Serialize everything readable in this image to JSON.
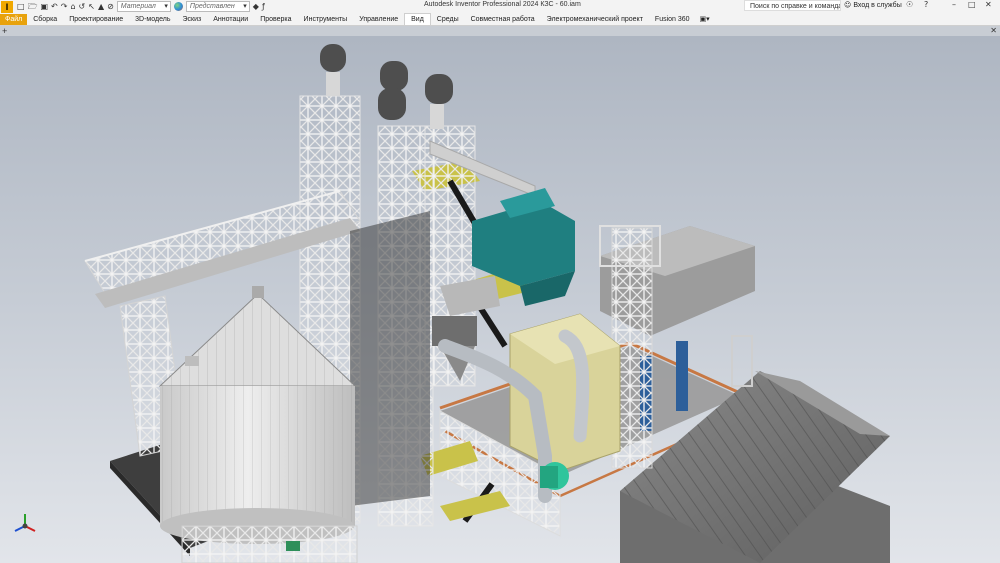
{
  "titlebar": {
    "logo": "I",
    "material_dropdown": "Материал",
    "appearance_dropdown": "Представлен",
    "app_title": "Autodesk Inventor Professional 2024  КЗС - 60.iam",
    "help_search_placeholder": "Поиск по справке и командам...",
    "sign_in": "Вход в службы"
  },
  "ribbon": {
    "file_tab": "Файл",
    "tabs": [
      "Сборка",
      "Проектирование",
      "3D-модель",
      "Эскиз",
      "Аннотации",
      "Проверка",
      "Инструменты",
      "Управление",
      "Вид",
      "Среды",
      "Совместная работа",
      "Электромеханический проект",
      "Fusion 360"
    ],
    "active_tab": "Вид"
  },
  "colors": {
    "ribbon_file_tab": "#e8a20c",
    "viewport_top": "#aeb6c2",
    "viewport_bottom": "#e2e5ea",
    "steel": "#d8d8d8",
    "motor_teal": "#1f7f80",
    "dryer_yellow": "#d9d39a",
    "walkway_yellow": "#c9c24a",
    "roof_grey": "#7e7e7e",
    "orange_rail": "#c77844",
    "blue_pump": "#2d5f9a",
    "green_fan": "#2fc59c"
  },
  "icons": [
    "file-new-icon",
    "open-icon",
    "save-icon",
    "undo-icon",
    "redo-icon",
    "home-icon",
    "return-icon",
    "select-icon",
    "measure-icon",
    "clear-override-icon",
    "appearance-ball-icon",
    "parameters-icon",
    "ilogic-icon",
    "user-icon",
    "cart-icon",
    "help-icon",
    "minimize-icon",
    "maximize-icon",
    "close-icon",
    "new-document-icon",
    "close-document-icon",
    "view-cube-triad-icon"
  ]
}
